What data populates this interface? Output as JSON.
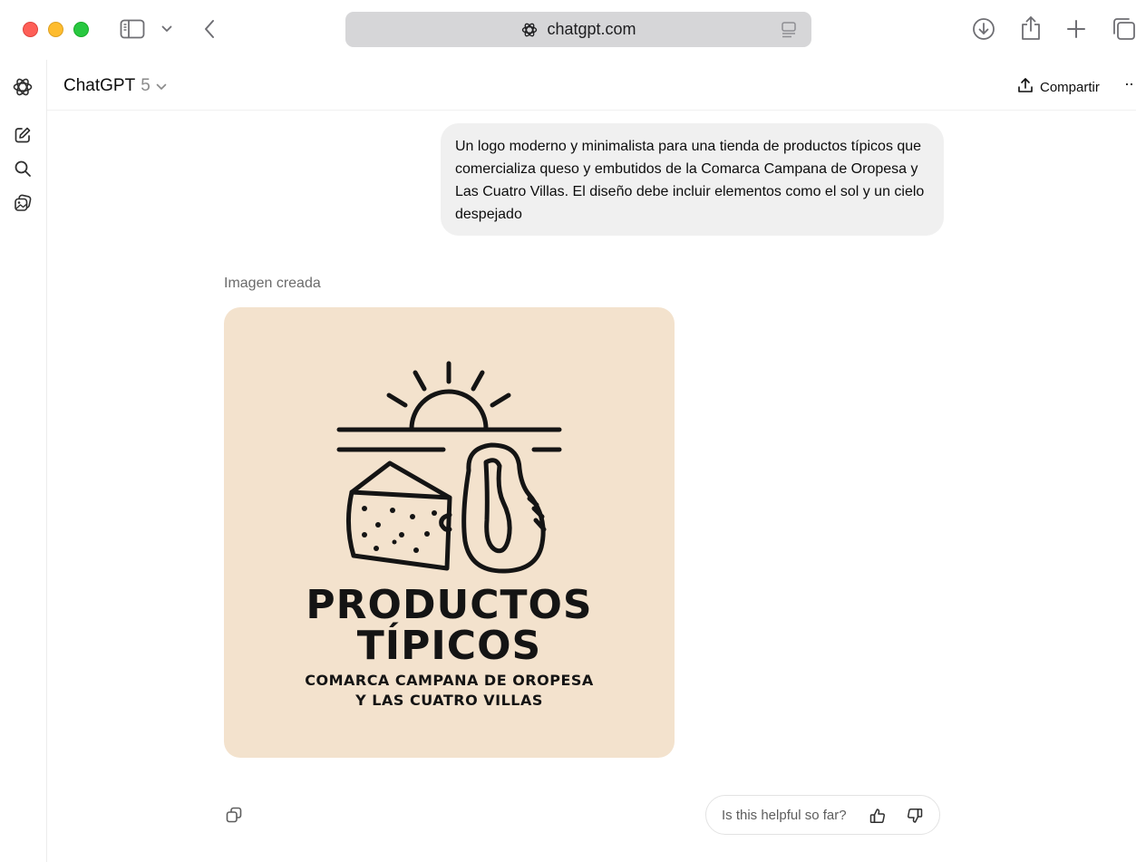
{
  "browser": {
    "url": "chatgpt.com"
  },
  "chat": {
    "model_name": "ChatGPT",
    "model_version": "5",
    "share_label": "Compartir",
    "more_label": "··"
  },
  "user_message": {
    "text": "Un logo moderno y minimalista para una tienda de productos típicos que comercializa queso y embutidos de la Comarca Campana de Oropesa y Las Cuatro Villas. El diseño debe incluir elementos como el sol y un cielo despejado"
  },
  "assistant": {
    "created_label": "Imagen creada",
    "image": {
      "background_color": "#f3e2cd",
      "ink_color": "#141414",
      "line1": "PRODUCTOS",
      "line2": "TÍPICOS",
      "line3": "COMARCA CAMPANA DE OROPESA",
      "line4": "Y LAS CUATRO VILLAS",
      "elements": [
        "sun-icon",
        "horizon-lines",
        "cheese-wedge-icon",
        "sausage-icon"
      ]
    },
    "feedback_prompt": "Is this helpful so far?"
  },
  "icons": {
    "toolbar": [
      "sidebar-icon",
      "chevron-down-icon",
      "back-arrow-icon",
      "download-icon",
      "share-icon",
      "new-tab-icon",
      "tabs-overview-icon"
    ],
    "rail": [
      "chatgpt-logo-icon",
      "new-chat-icon",
      "search-icon",
      "library-icon"
    ],
    "response": [
      "copy-icon",
      "thumbs-up-icon",
      "thumbs-down-icon"
    ]
  }
}
